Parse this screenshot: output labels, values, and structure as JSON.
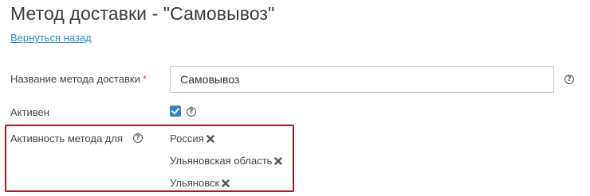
{
  "header": {
    "title": "Метод доставки - \"Самовывоз\"",
    "back_link": "Вернуться назад"
  },
  "form": {
    "name_field": {
      "label": "Название метода доставки",
      "required_mark": "*",
      "value": "Самовывоз",
      "help": "?"
    },
    "active_field": {
      "label": "Активен",
      "checked": true,
      "help": "?"
    },
    "regions_field": {
      "label": "Активность метода для",
      "help": "?",
      "items": [
        {
          "label": "Россия"
        },
        {
          "label": "Ульяновская область"
        },
        {
          "label": "Ульяновск"
        }
      ]
    }
  },
  "colors": {
    "link": "#2a8fd1",
    "checkbox": "#2f86cf",
    "highlight_border": "#a01d22",
    "required": "#d9534f"
  },
  "icons": {
    "help": "question-circle-icon",
    "checkmark": "checkmark-icon",
    "remove": "close-icon"
  }
}
